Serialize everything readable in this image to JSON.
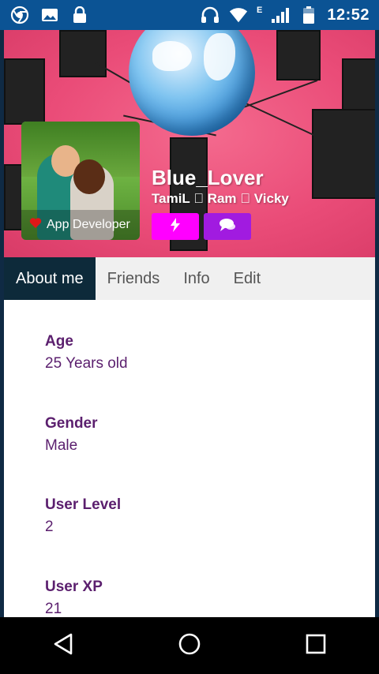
{
  "status_bar": {
    "time": "12:52",
    "network_label": "E",
    "icons": [
      "chrome-icon",
      "image-icon",
      "lock-icon",
      "headset-icon",
      "wifi-icon",
      "signal-icon",
      "battery-icon"
    ]
  },
  "profile": {
    "username": "Blue_Lover",
    "tagline": "TamiL \u0000 Ram \u0000 Vicky",
    "role_label": "App Developer",
    "action_buttons": [
      {
        "icon": "lightning-icon",
        "color": "#ff00ff"
      },
      {
        "icon": "chat-icon",
        "color": "#a11be0"
      }
    ]
  },
  "tabs": [
    {
      "label": "About me",
      "active": true
    },
    {
      "label": "Friends",
      "active": false
    },
    {
      "label": "Info",
      "active": false
    },
    {
      "label": "Edit",
      "active": false
    }
  ],
  "about": [
    {
      "label": "Age",
      "value": "25 Years old"
    },
    {
      "label": "Gender",
      "value": "Male"
    },
    {
      "label": "User Level",
      "value": "2"
    },
    {
      "label": "User XP",
      "value": "21"
    }
  ],
  "nav_bar": {
    "icons": [
      "back-icon",
      "home-icon",
      "recents-icon"
    ]
  },
  "colors": {
    "cover_pink": "#ea4c78",
    "active_tab": "#0d2a3a",
    "label_purple": "#5b1f6e",
    "status_bar": "#0b5394"
  }
}
